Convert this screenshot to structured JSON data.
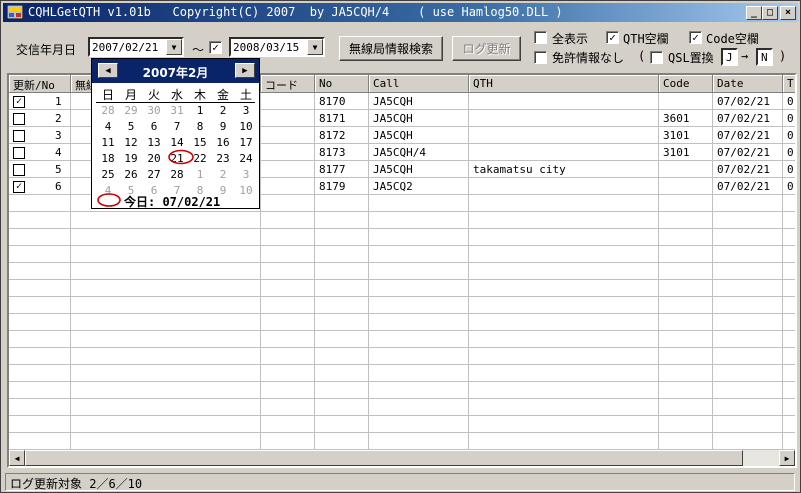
{
  "window": {
    "title": "CQHLGetQTH v1.01b   Copyright(C) 2007  by JA5CQH/4    ( use Hamlog50.DLL )",
    "minimize": "_",
    "maximize": "□",
    "close": "×"
  },
  "toolbar": {
    "date_label": "交信年月日",
    "date_from": "2007/02/21",
    "tilde": "～",
    "date_to_checked": "✓",
    "date_to": "2008/03/15",
    "search_button": "無線局情報検索",
    "log_update_button": "ログ更新",
    "show_all_label": "全表示",
    "show_all_checked": "",
    "qth_empty_label": "QTH空欄",
    "qth_empty_checked": "✓",
    "code_empty_label": "Code空欄",
    "code_empty_checked": "✓",
    "no_license_label": "免許情報なし",
    "no_license_checked": "",
    "paren_open": "(",
    "qsl_replace_label": "QSL置換",
    "qsl_replace_checked": "",
    "qsl_from": "J",
    "arrow": "→",
    "qsl_to": "N",
    "paren_close": ")"
  },
  "table": {
    "headers": [
      "更新/No",
      "無線",
      "",
      "コード",
      "No",
      "Call",
      "QTH",
      "Code",
      "Date",
      "T"
    ],
    "rows": [
      {
        "checked": "✓",
        "no": "1",
        "log_no": "8170",
        "call": "JA5CQH",
        "qth": "",
        "code": "",
        "date": "07/02/21",
        "t": "0"
      },
      {
        "checked": "",
        "no": "2",
        "log_no": "8171",
        "call": "JA5CQH",
        "qth": "",
        "code": "3601",
        "date": "07/02/21",
        "t": "0"
      },
      {
        "checked": "",
        "no": "3",
        "log_no": "8172",
        "call": "JA5CQH",
        "qth": "",
        "code": "3101",
        "date": "07/02/21",
        "t": "0"
      },
      {
        "checked": "",
        "no": "4",
        "log_no": "8173",
        "call": "JA5CQH/4",
        "qth": "",
        "code": "3101",
        "date": "07/02/21",
        "t": "0"
      },
      {
        "checked": "",
        "no": "5",
        "log_no": "8177",
        "call": "JA5CQH",
        "qth": "takamatsu city",
        "code": "",
        "date": "07/02/21",
        "t": "0"
      },
      {
        "checked": "✓",
        "no": "6",
        "log_no": "8179",
        "call": "JA5CQ2",
        "qth": "",
        "code": "",
        "date": "07/02/21",
        "t": "0"
      }
    ]
  },
  "calendar": {
    "title": "2007年2月",
    "prev": "◀",
    "next": "▶",
    "dow": [
      "日",
      "月",
      "火",
      "水",
      "木",
      "金",
      "土"
    ],
    "weeks": [
      [
        "28",
        "29",
        "30",
        "31",
        "1",
        "2",
        "3"
      ],
      [
        "4",
        "5",
        "6",
        "7",
        "8",
        "9",
        "10"
      ],
      [
        "11",
        "12",
        "13",
        "14",
        "15",
        "16",
        "17"
      ],
      [
        "18",
        "19",
        "20",
        "21",
        "22",
        "23",
        "24"
      ],
      [
        "25",
        "26",
        "27",
        "28",
        "1",
        "2",
        "3"
      ],
      [
        "4",
        "5",
        "6",
        "7",
        "8",
        "9",
        "10"
      ]
    ],
    "today_label": "今日: 07/02/21",
    "accent": "#cc0000",
    "header_color": "#0a246a"
  },
  "status": {
    "text": "ログ更新対象 2／6／10"
  }
}
